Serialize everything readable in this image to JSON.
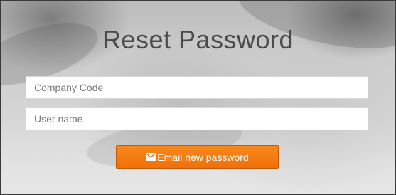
{
  "form": {
    "title": "Reset Password",
    "company_code_placeholder": "Company Code",
    "username_placeholder": "User name",
    "company_code_value": "",
    "username_value": "",
    "submit_label": "Email new password",
    "submit_icon": "envelope-icon"
  },
  "colors": {
    "accent": "#f07a10",
    "title_text": "#4b4b4b",
    "field_background": "#ffffff"
  }
}
